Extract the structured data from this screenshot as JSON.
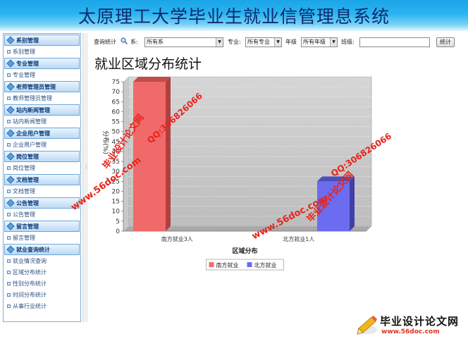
{
  "header": {
    "title": "太原理工大学毕业生就业信管理息系统"
  },
  "sidebar": {
    "sections": [
      {
        "label": "系别管理",
        "items": [
          "系别管理"
        ]
      },
      {
        "label": "专业管理",
        "items": [
          "专业管理"
        ]
      },
      {
        "label": "老师管理员管理",
        "items": [
          "教师管理员管理"
        ]
      },
      {
        "label": "站内新闻管理",
        "items": [
          "站内新闻管理"
        ]
      },
      {
        "label": "企业用户管理",
        "items": [
          "企业用户管理"
        ]
      },
      {
        "label": "岗位管理",
        "items": [
          "岗位管理"
        ]
      },
      {
        "label": "文档管理",
        "items": [
          "文档管理"
        ]
      },
      {
        "label": "公告管理",
        "items": [
          "公告管理"
        ]
      },
      {
        "label": "留言管理",
        "items": [
          "留言管理"
        ]
      },
      {
        "label": "就业查询统计",
        "items": [
          "就业情况查询",
          "区域分布统计",
          "性别分布统计",
          "时间分布统计",
          "从事行业统计"
        ]
      }
    ]
  },
  "filters": {
    "query_label": "查询统计",
    "dept_label": "系:",
    "dept_value": "所有系",
    "major_label": "专业:",
    "major_value": "所有专业",
    "grade_label": "年级",
    "grade_value": "所有年级",
    "class_label": "班级:",
    "class_value": "",
    "submit_label": "统计"
  },
  "page": {
    "heading": "就业区域分布统计"
  },
  "chart_data": {
    "type": "bar",
    "categories": [
      "南方就业3人",
      "北方就业1人"
    ],
    "series": [
      {
        "name": "南方就业",
        "values": [
          75,
          0
        ],
        "color": "#f06a6a"
      },
      {
        "name": "北方就业",
        "values": [
          0,
          25
        ],
        "color": "#6b6cf0"
      }
    ],
    "xlabel": "区域分布",
    "ylabel": "分布(%)",
    "ylim": [
      0,
      75
    ],
    "yticks": [
      0,
      5,
      10,
      15,
      20,
      25,
      30,
      35,
      40,
      45,
      50,
      55,
      60,
      65,
      70,
      75
    ],
    "grid": true,
    "legend_position": "bottom-center",
    "style": "3d"
  },
  "watermarks": {
    "site_url": "www.56doc.com",
    "site_name": "毕业设计论文网",
    "qq": "QQ:306826066"
  },
  "logo": {
    "name": "毕业设计论文网",
    "url": "www.56doc.com"
  }
}
